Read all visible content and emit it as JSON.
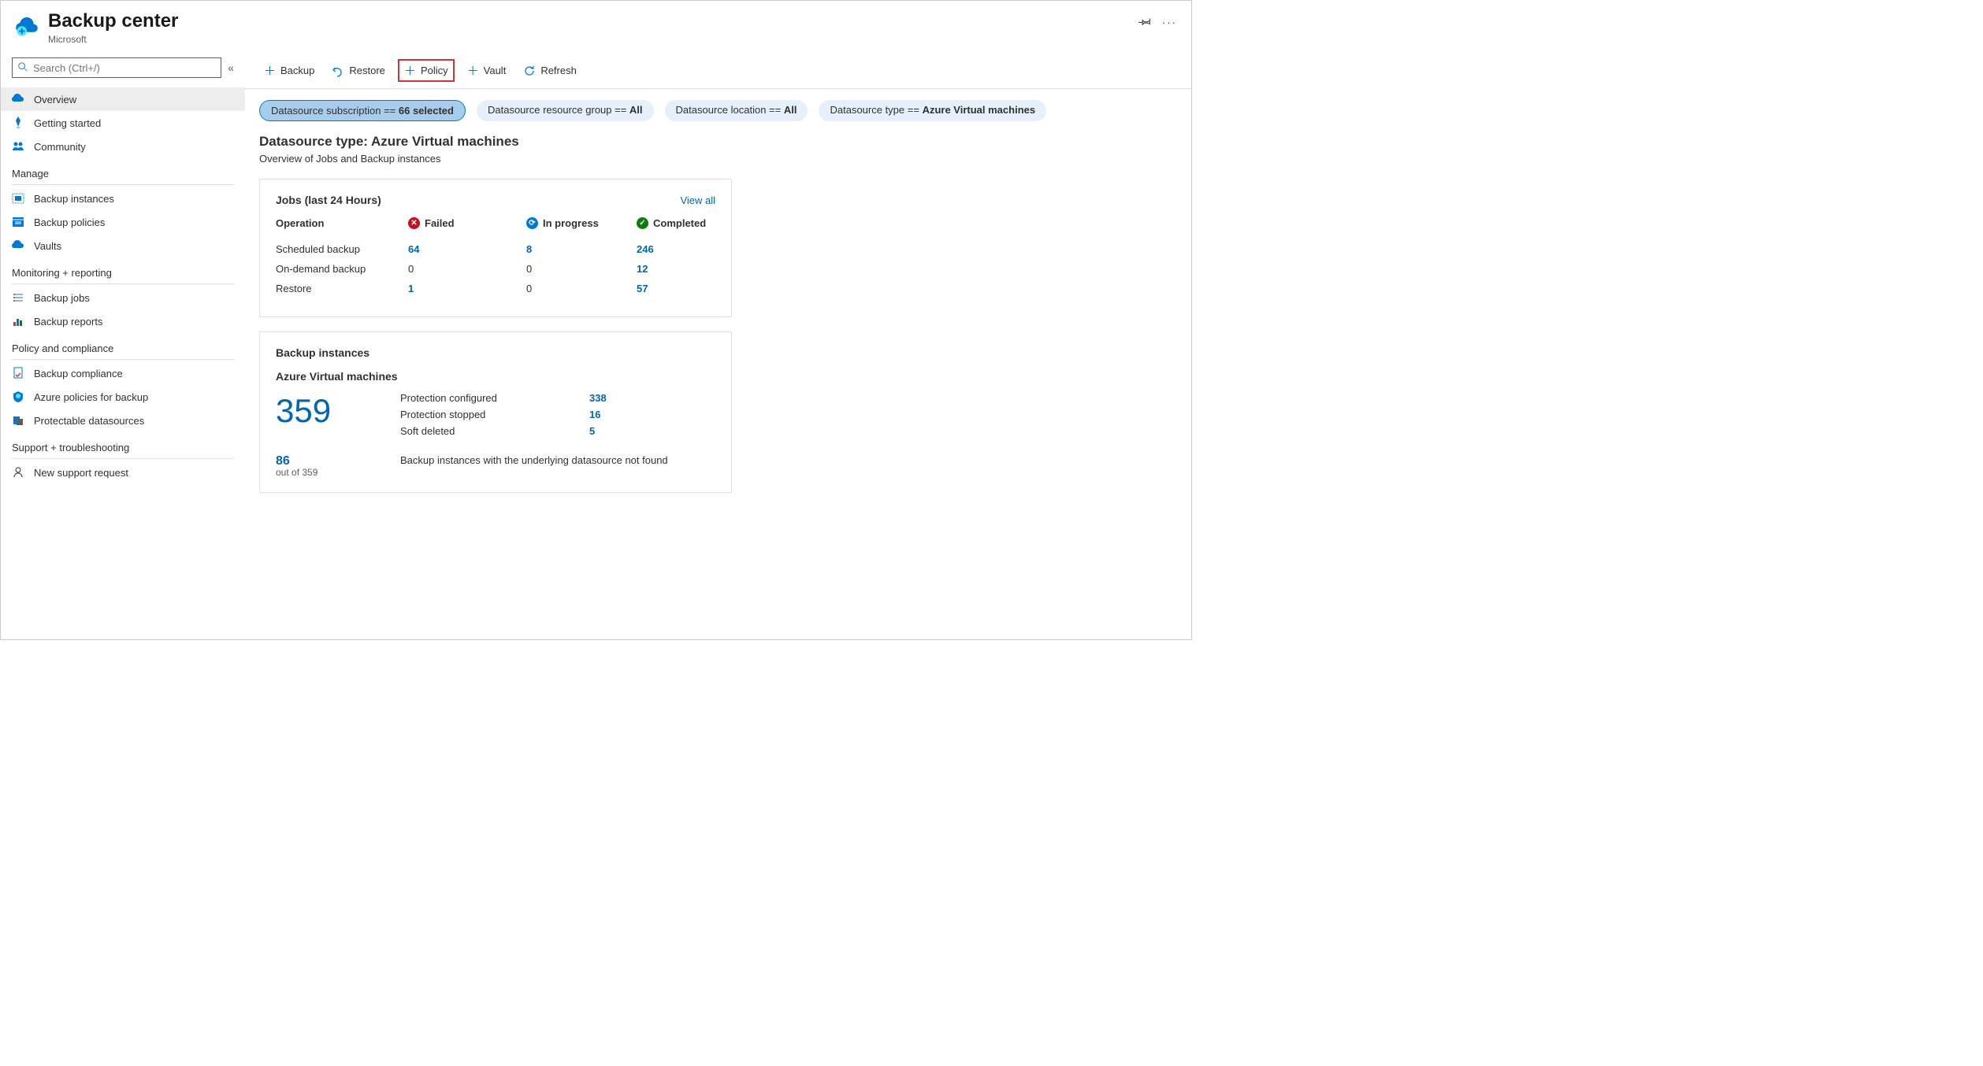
{
  "header": {
    "title": "Backup center",
    "subtitle": "Microsoft"
  },
  "search": {
    "placeholder": "Search (Ctrl+/)"
  },
  "sidebar": {
    "items": [
      {
        "label": "Overview"
      },
      {
        "label": "Getting started"
      },
      {
        "label": "Community"
      }
    ],
    "sections": [
      {
        "title": "Manage",
        "items": [
          {
            "label": "Backup instances"
          },
          {
            "label": "Backup policies"
          },
          {
            "label": "Vaults"
          }
        ]
      },
      {
        "title": "Monitoring + reporting",
        "items": [
          {
            "label": "Backup jobs"
          },
          {
            "label": "Backup reports"
          }
        ]
      },
      {
        "title": "Policy and compliance",
        "items": [
          {
            "label": "Backup compliance"
          },
          {
            "label": "Azure policies for backup"
          },
          {
            "label": "Protectable datasources"
          }
        ]
      },
      {
        "title": "Support + troubleshooting",
        "items": [
          {
            "label": "New support request"
          }
        ]
      }
    ]
  },
  "toolbar": {
    "backup": "Backup",
    "restore": "Restore",
    "policy": "Policy",
    "vault": "Vault",
    "refresh": "Refresh"
  },
  "filters": {
    "subscription": {
      "label": "Datasource subscription == ",
      "value": "66 selected"
    },
    "rg": {
      "label": "Datasource resource group == ",
      "value": "All"
    },
    "location": {
      "label": "Datasource location == ",
      "value": "All"
    },
    "type": {
      "label": "Datasource type == ",
      "value": "Azure Virtual machines"
    }
  },
  "main": {
    "title": "Datasource type: Azure Virtual machines",
    "subtitle": "Overview of Jobs and Backup instances"
  },
  "jobs": {
    "title": "Jobs (last 24 Hours)",
    "view_all": "View all",
    "headers": {
      "op": "Operation",
      "failed": "Failed",
      "inprogress": "In progress",
      "completed": "Completed"
    },
    "rows": [
      {
        "op": "Scheduled backup",
        "failed": "64",
        "inprogress": "8",
        "completed": "246"
      },
      {
        "op": "On-demand backup",
        "failed": "0",
        "inprogress": "0",
        "completed": "12"
      },
      {
        "op": "Restore",
        "failed": "1",
        "inprogress": "0",
        "completed": "57"
      }
    ]
  },
  "instances": {
    "title": "Backup instances",
    "subtitle": "Azure Virtual machines",
    "total": "359",
    "rows": [
      {
        "label": "Protection configured",
        "value": "338"
      },
      {
        "label": "Protection stopped",
        "value": "16"
      },
      {
        "label": "Soft deleted",
        "value": "5"
      }
    ],
    "notfound_count": "86",
    "notfound_outof": "out of 359",
    "notfound_text": "Backup instances with the underlying datasource not found"
  }
}
